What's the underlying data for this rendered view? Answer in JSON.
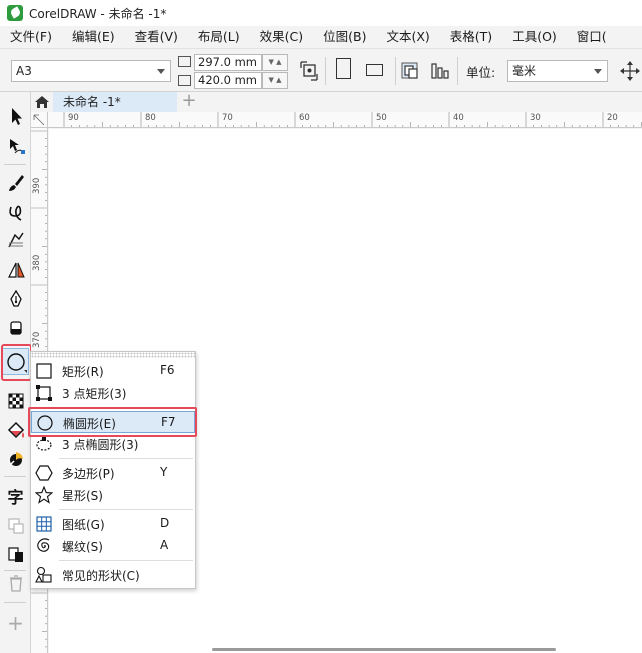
{
  "window": {
    "title": "CorelDRAW - 未命名 -1*",
    "accent_color": "#2e9b3e"
  },
  "menu": {
    "items": [
      "文件(F)",
      "编辑(E)",
      "查看(V)",
      "布局(L)",
      "效果(C)",
      "位图(B)",
      "文本(X)",
      "表格(T)",
      "工具(O)",
      "窗口("
    ]
  },
  "propbar": {
    "paper_size": "A3",
    "width": "297.0 mm",
    "height": "420.0 mm",
    "units_label": "单位:",
    "units_value": "毫米"
  },
  "document": {
    "tab_label": "未命名 -1*",
    "add_tab": "+"
  },
  "ruler": {
    "top_labels": [
      "90",
      "80",
      "70",
      "60",
      "50",
      "40",
      "30",
      "20"
    ],
    "left_labels": [
      "390",
      "380",
      "370"
    ]
  },
  "toolbox": {
    "text_tool_glyph": "字",
    "add_tool_glyph": "+"
  },
  "flyout": {
    "items": [
      {
        "label": "矩形(R)",
        "shortcut": "F6"
      },
      {
        "label": "3 点矩形(3)",
        "shortcut": ""
      },
      {
        "label": "椭圆形(E)",
        "shortcut": "F7"
      },
      {
        "label": "3 点椭圆形(3)",
        "shortcut": ""
      },
      {
        "label": "多边形(P)",
        "shortcut": "Y"
      },
      {
        "label": "星形(S)",
        "shortcut": ""
      },
      {
        "label": "图纸(G)",
        "shortcut": "D"
      },
      {
        "label": "螺纹(S)",
        "shortcut": "A"
      },
      {
        "label": "常见的形状(C)",
        "shortcut": ""
      }
    ],
    "selected_color": "#dceaf8",
    "highlight_color": "#e64a5a"
  }
}
